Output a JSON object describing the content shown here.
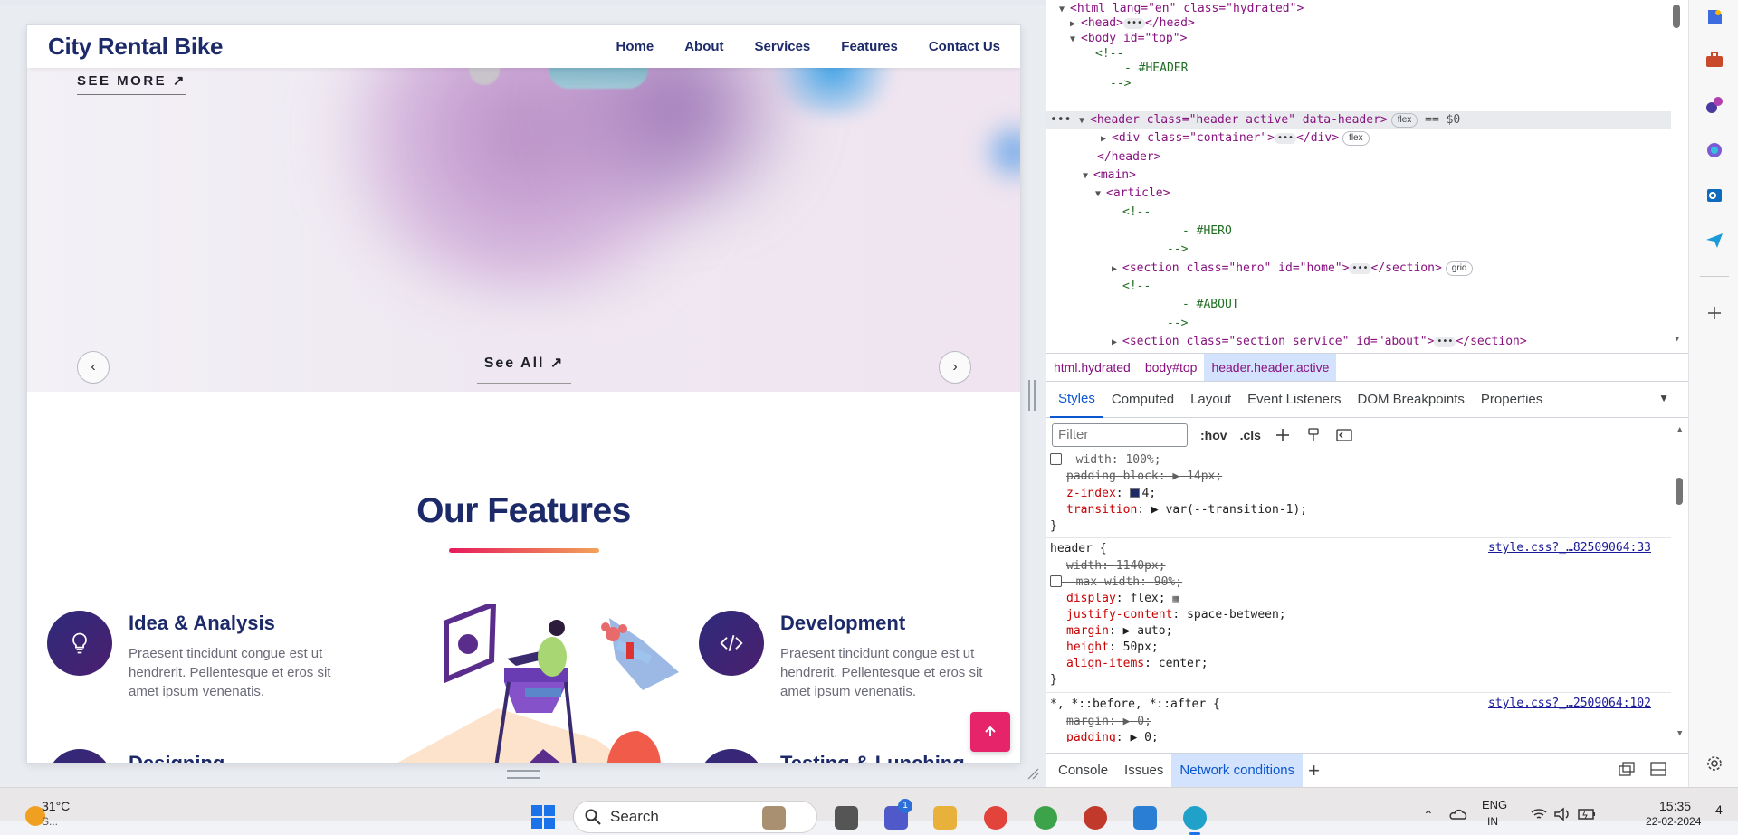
{
  "site": {
    "logo": "City Rental Bike",
    "nav": [
      "Home",
      "About",
      "Services",
      "Features",
      "Contact Us"
    ],
    "hero_link": "SEE MORE ↗",
    "see_all": "See All ↗",
    "carousel_prev": "‹",
    "carousel_next": "›",
    "features_title": "Our Features",
    "features": [
      {
        "title": "Idea & Analysis",
        "desc": "Praesent tincidunt congue est ut hendrerit. Pellentesque et eros sit amet ipsum venenatis."
      },
      {
        "title": "Development",
        "desc": "Praesent tincidunt congue est ut hendrerit. Pellentesque et eros sit amet ipsum venenatis."
      },
      {
        "title": "Designing"
      },
      {
        "title": "Testing & Lunching"
      }
    ],
    "accent_colors": {
      "primary": "#1d2a6a",
      "pink": "#e6246a",
      "gradient_end": "#f2a35a"
    }
  },
  "devtools": {
    "tree": [
      "<html lang=\"en\" class=\"hydrated\">",
      "<head>",
      "</head>",
      "<body id=\"top\">",
      "<!--",
      "- #HEADER",
      "-->",
      "<header class=\"header active\" data-header>",
      "flex",
      "== $0",
      "<div class=\"container\">",
      "</div>",
      "flex",
      "</header>",
      "<main>",
      "<article>",
      "<!--",
      "- #HERO",
      "-->",
      "<section class=\"hero\" id=\"home\">",
      "</section>",
      "grid",
      "<!--",
      "- #ABOUT",
      "-->",
      "<section class=\"section service\" id=\"about\">",
      "</section>"
    ],
    "breadcrumbs": [
      "html.hydrated",
      "body#top",
      "header.header.active"
    ],
    "tabs": [
      "Styles",
      "Computed",
      "Layout",
      "Event Listeners",
      "DOM Breakpoints",
      "Properties"
    ],
    "active_tab": "Styles",
    "filter_placeholder": "Filter",
    "toolbar": {
      "hov": ":hov",
      "cls": ".cls"
    },
    "styles": {
      "rule0": [
        {
          "prop": "width",
          "value": "100%;",
          "struck": true
        },
        {
          "prop": "padding-block",
          "value": "14px;",
          "struck": true
        },
        {
          "prop": "z-index",
          "value": "4;"
        },
        {
          "prop": "transition",
          "value": "var(--transition-1);"
        }
      ],
      "rule1_selector": "header {",
      "rule1_source": "style.css?_…82509064:33",
      "rule1": [
        {
          "prop": "width",
          "value": "1140px;",
          "struck": true
        },
        {
          "prop": "max-width",
          "value": "90%;",
          "struck": true
        },
        {
          "prop": "display",
          "value": "flex;"
        },
        {
          "prop": "justify-content",
          "value": "space-between;"
        },
        {
          "prop": "margin",
          "value": "auto;"
        },
        {
          "prop": "height",
          "value": "50px;"
        },
        {
          "prop": "align-items",
          "value": "center;"
        }
      ],
      "rule2_selector": "*, *::before, *::after {",
      "rule2_source": "style.css?_…2509064:102",
      "rule2": [
        {
          "prop": "margin",
          "value": "0;",
          "struck": true
        },
        {
          "prop": "padding",
          "value": "0;"
        }
      ],
      "close_brace": "}"
    },
    "drawer_tabs": [
      "Console",
      "Issues",
      "Network conditions"
    ],
    "drawer_active": "Network conditions"
  },
  "taskbar": {
    "weather_temp": "31°C",
    "weather_sub": "S...",
    "search_label": "Search",
    "lang": "ENG",
    "lang_sub": "IN",
    "time": "15:35",
    "date": "22-02-2024",
    "teams_badge": "1",
    "notif_count": "4"
  }
}
